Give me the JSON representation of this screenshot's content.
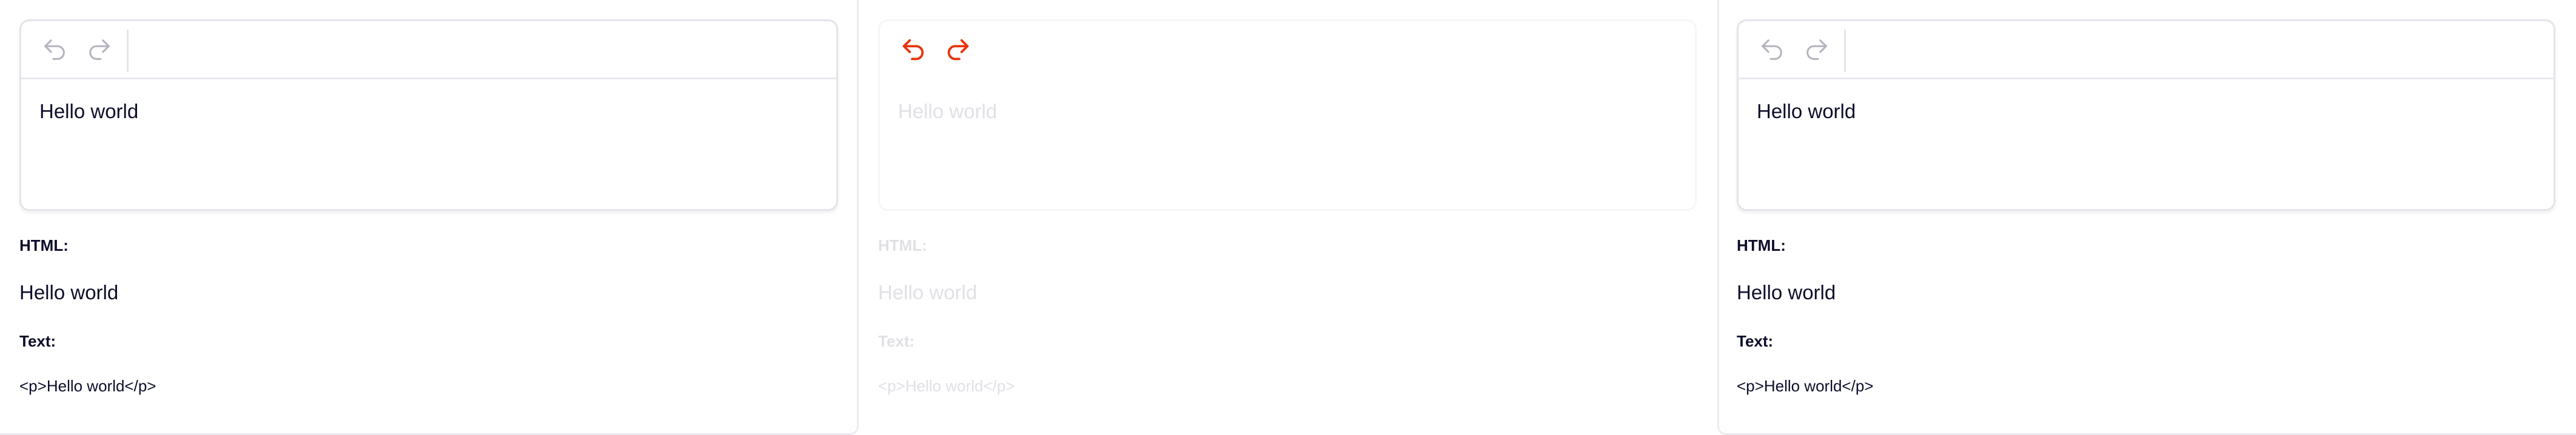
{
  "panels": [
    {
      "editor_text": "Hello world",
      "html_label": "HTML:",
      "html_output": "Hello world",
      "text_label": "Text:",
      "text_output": "<p>Hello world</p>",
      "undo_icon": "undo-icon",
      "redo_icon": "redo-icon"
    },
    {
      "editor_text": "Hello world",
      "html_label": "HTML:",
      "html_output": "Hello world",
      "text_label": "Text:",
      "text_output": "<p>Hello world</p>",
      "undo_icon": "undo-icon",
      "redo_icon": "redo-icon"
    },
    {
      "editor_text": "Hello world",
      "html_label": "HTML:",
      "html_output": "Hello world",
      "text_label": "Text:",
      "text_output": "<p>Hello world</p>",
      "undo_icon": "undo-icon",
      "redo_icon": "redo-icon"
    }
  ],
  "colors": {
    "icon_inactive": "#b4b4c0",
    "icon_active": "#e8340c",
    "text": "#0d0d2b",
    "faded_text": "#e0e0e6"
  }
}
